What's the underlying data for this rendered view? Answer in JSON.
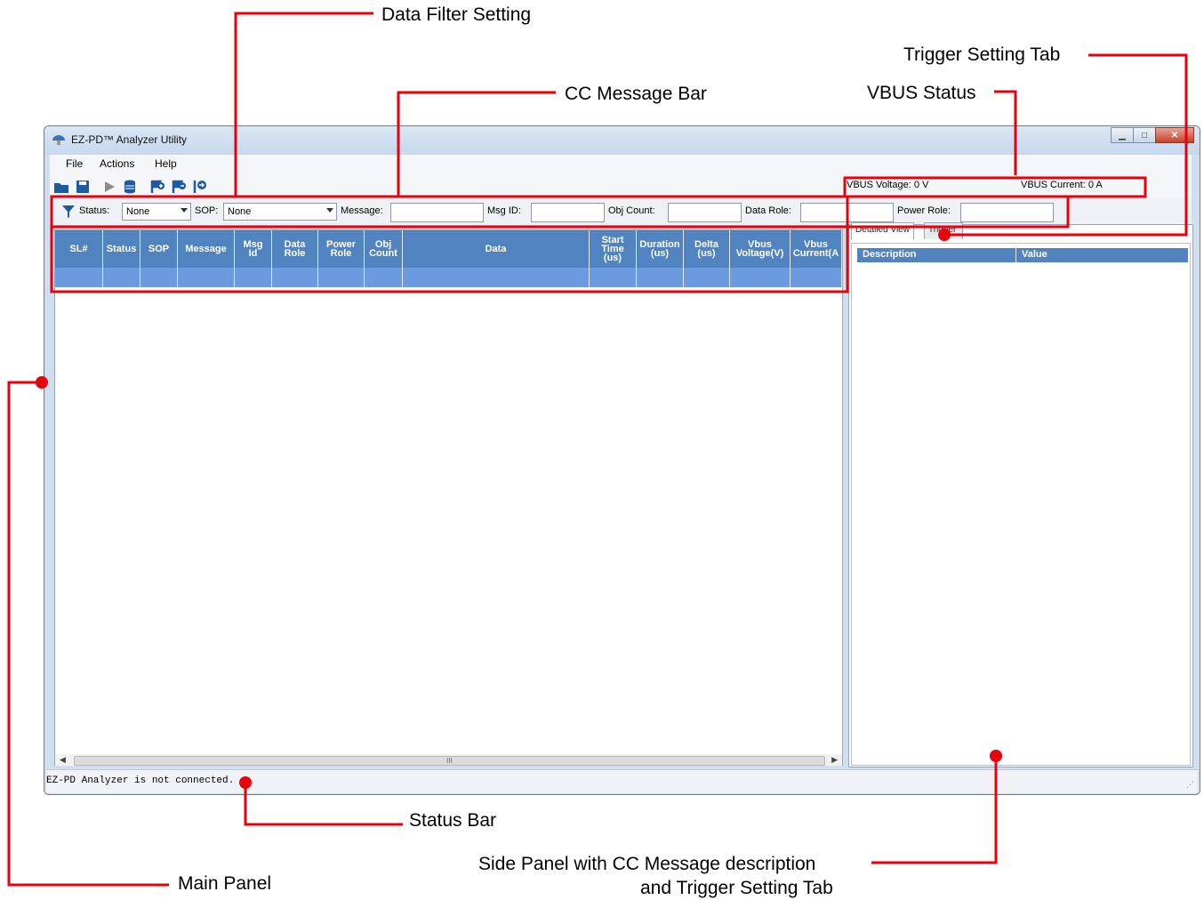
{
  "callouts": {
    "data_filter": "Data Filter Setting",
    "trigger_tab": "Trigger Setting Tab",
    "cc_message_bar": "CC Message Bar",
    "vbus_status": "VBUS Status",
    "status_bar": "Status Bar",
    "main_panel": "Main Panel",
    "side_panel_line1": "Side Panel with CC Message description",
    "side_panel_line2": "and Trigger Setting Tab"
  },
  "colors": {
    "callout": "#e8000b",
    "grid_header": "#5283c1",
    "grid_row": "#6b9ae0"
  },
  "window": {
    "title": "EZ-PD™ Analyzer Utility"
  },
  "menu": {
    "file": "File",
    "actions": "Actions",
    "help": "Help"
  },
  "toolbar": {
    "icons": [
      "open-folder-icon",
      "save-icon",
      "play-icon",
      "database-icon",
      "add-trigger-icon",
      "remove-trigger-icon",
      "export-icon"
    ]
  },
  "vbus": {
    "voltage_label": "VBUS Voltage:",
    "voltage_value": "0 V",
    "current_label": "VBUS Current:",
    "current_value": "0 A"
  },
  "filter": {
    "status_label": "Status:",
    "status_value": "None",
    "sop_label": "SOP:",
    "sop_value": "None",
    "message_label": "Message:",
    "msgid_label": "Msg ID:",
    "objcount_label": "Obj Count:",
    "datarole_label": "Data Role:",
    "powerrole_label": "Power Role:"
  },
  "grid": {
    "columns": [
      {
        "key": "sl",
        "label": "SL#"
      },
      {
        "key": "status",
        "label": "Status"
      },
      {
        "key": "sop",
        "label": "SOP"
      },
      {
        "key": "message",
        "label": "Message"
      },
      {
        "key": "msgid",
        "label": "Msg\nId"
      },
      {
        "key": "datarole",
        "label": "Data\nRole"
      },
      {
        "key": "powerrole",
        "label": "Power\nRole"
      },
      {
        "key": "objcount",
        "label": "Obj\nCount"
      },
      {
        "key": "data",
        "label": "Data"
      },
      {
        "key": "start",
        "label": "Start\nTime\n(us)"
      },
      {
        "key": "duration",
        "label": "Duration\n(us)"
      },
      {
        "key": "delta",
        "label": "Delta\n(us)"
      },
      {
        "key": "vbusv",
        "label": "Vbus\nVoltage(V)"
      },
      {
        "key": "vbusc",
        "label": "Vbus\nCurrent(A"
      }
    ],
    "scroll_thumb": "III"
  },
  "side": {
    "tab_detailed": "Detailed View",
    "tab_trigger": "Trigger",
    "col_description": "Description",
    "col_value": "Value"
  },
  "status": {
    "text": "EZ-PD Analyzer is not connected."
  }
}
